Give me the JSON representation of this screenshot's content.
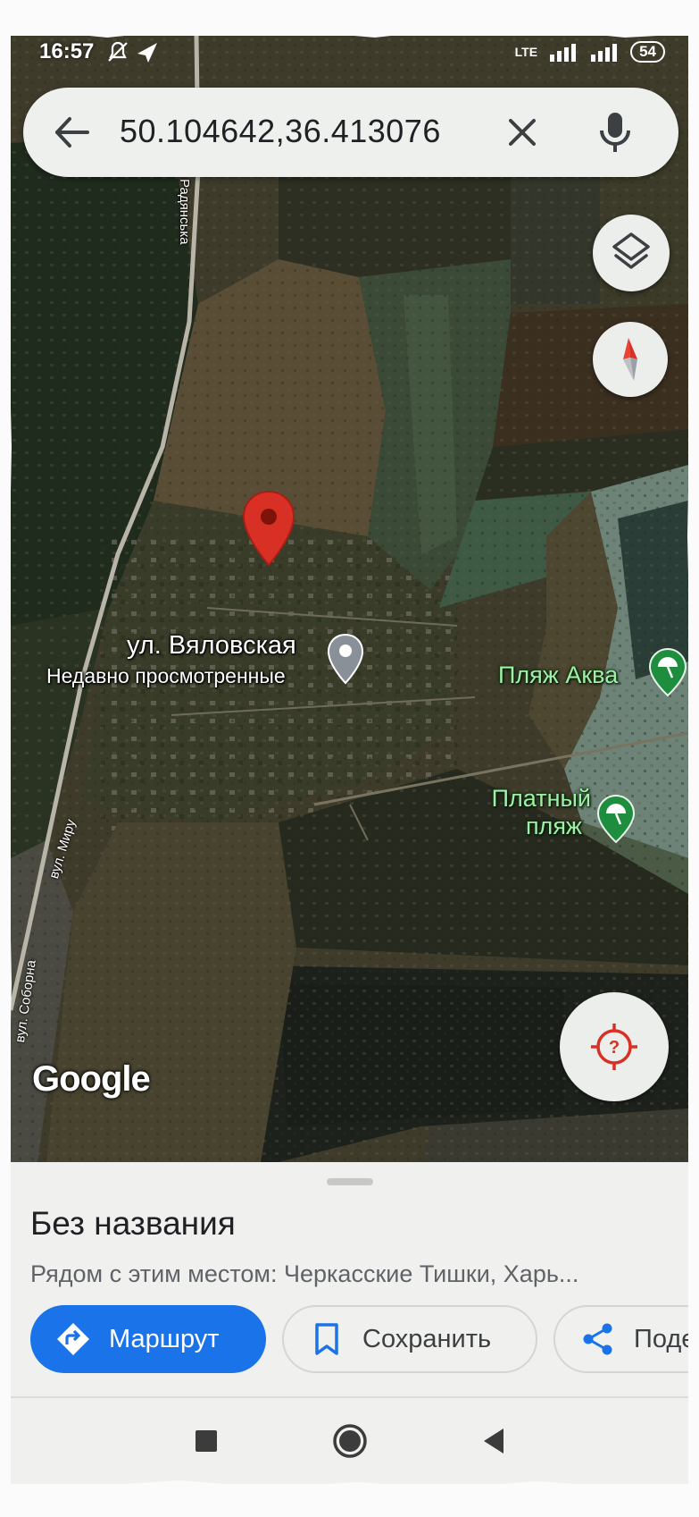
{
  "status_bar": {
    "time": "16:57",
    "network": "LTE",
    "battery": "54"
  },
  "search": {
    "query": "50.104642,36.413076"
  },
  "map": {
    "labels": {
      "street_main": "ул. Вяловская",
      "street_sub": "Недавно просмотренные",
      "poi_1": "Пляж Аква",
      "poi_2_line1": "Платный",
      "poi_2_line2": "пляж",
      "road_1": "Радянська",
      "road_2": "вул. Миру",
      "road_3": "вул. Соборна"
    },
    "attribution": "Google",
    "pin_color": "#d93025",
    "poi_color": "#1e8e3e"
  },
  "sheet": {
    "title": "Без названия",
    "subtitle": "Рядом с этим местом: Черкасские Тишки, Харь...",
    "actions": {
      "route": "Маршрут",
      "save": "Сохранить",
      "share": "Поде"
    },
    "accent": "#1a73e8"
  },
  "icons": {
    "back": "arrow-left",
    "clear": "close",
    "mic": "microphone",
    "layers": "layers",
    "compass": "compass",
    "locate": "my-location"
  }
}
